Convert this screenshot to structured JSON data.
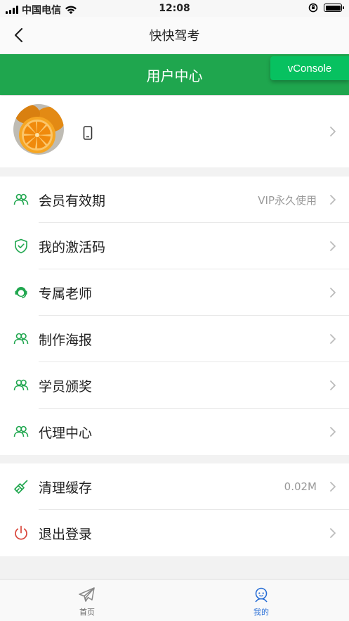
{
  "status_bar": {
    "carrier": "中国电信",
    "time": "12:08"
  },
  "nav": {
    "title": "快快驾考"
  },
  "header": {
    "title": "用户中心"
  },
  "vconsole": {
    "label": "vConsole"
  },
  "menu_group1": [
    {
      "label": "会员有效期",
      "value": "VIP永久使用",
      "icon": "users-icon"
    },
    {
      "label": "我的激活码",
      "value": "",
      "icon": "shield-check-icon"
    },
    {
      "label": "专属老师",
      "value": "",
      "icon": "headset-icon"
    },
    {
      "label": "制作海报",
      "value": "",
      "icon": "users-icon"
    },
    {
      "label": "学员颁奖",
      "value": "",
      "icon": "users-icon"
    },
    {
      "label": "代理中心",
      "value": "",
      "icon": "users-icon"
    }
  ],
  "menu_group2": [
    {
      "label": "清理缓存",
      "value": "0.02M",
      "icon": "broom-icon"
    },
    {
      "label": "退出登录",
      "value": "",
      "icon": "power-icon"
    }
  ],
  "tabbar": [
    {
      "label": "首页",
      "icon": "paper-plane-icon",
      "active": false
    },
    {
      "label": "我的",
      "icon": "user-face-icon",
      "active": true
    }
  ],
  "colors": {
    "accent": "#1fa64e",
    "vconsole": "#07c160",
    "tab_active": "#2a6fd6",
    "power": "#d9463b"
  }
}
